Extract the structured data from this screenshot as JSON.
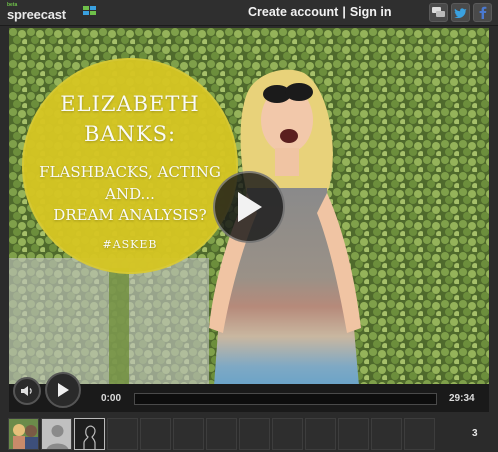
{
  "header": {
    "logo_text": "spreecast",
    "logo_badge": "beta",
    "create_account": "Create account",
    "separator": "|",
    "sign_in": "Sign in",
    "icons": [
      "chat-icon",
      "twitter-icon",
      "facebook-icon"
    ]
  },
  "video": {
    "title_lines": [
      "ELIZABETH",
      "BANKS:",
      "FLASHBACKS, ACTING",
      "AND...",
      "DREAM ANALYSIS?",
      "#ASKEB"
    ]
  },
  "player": {
    "current_time": "0:00",
    "duration": "29:34",
    "progress": 0
  },
  "viewers_count": "3",
  "colors": {
    "accent_yellow": "#d6c623",
    "twitter": "#3aa1e0",
    "facebook": "#3b5998",
    "brand_green": "#6fc04a"
  }
}
